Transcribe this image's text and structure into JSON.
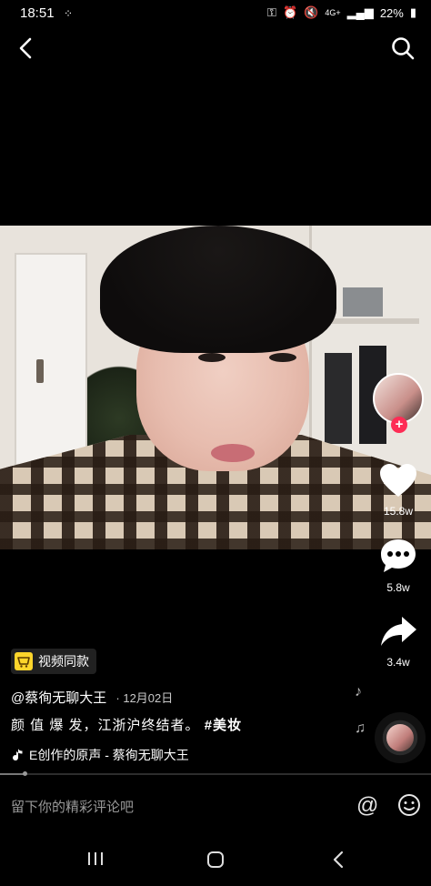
{
  "status_bar": {
    "time": "18:51",
    "battery": "22%",
    "network": "4G+"
  },
  "video": {
    "like_count": "15.8w",
    "comment_count": "5.8w",
    "share_count": "3.4w"
  },
  "product_tag": {
    "label": "视频同款"
  },
  "author": {
    "handle": "@蔡徇无聊大王",
    "date": "· 12月02日"
  },
  "caption": {
    "text": "颜 值 爆 发，江浙沪终结者。",
    "hashtag": "#美妆"
  },
  "music": {
    "title": "E创作的原声 - 蔡徇无聊大王"
  },
  "progress": {
    "played_fraction": 0.06
  },
  "comment_bar": {
    "placeholder": "留下你的精彩评论吧"
  },
  "colors": {
    "accent": "#fe2c55",
    "product_tag": "#fdd52b",
    "background": "#000000"
  },
  "icons": [
    "back-icon",
    "search-icon",
    "heart-icon",
    "comment-icon",
    "share-icon",
    "music-note-icon",
    "at-icon",
    "emoji-icon",
    "product-cart-icon"
  ]
}
